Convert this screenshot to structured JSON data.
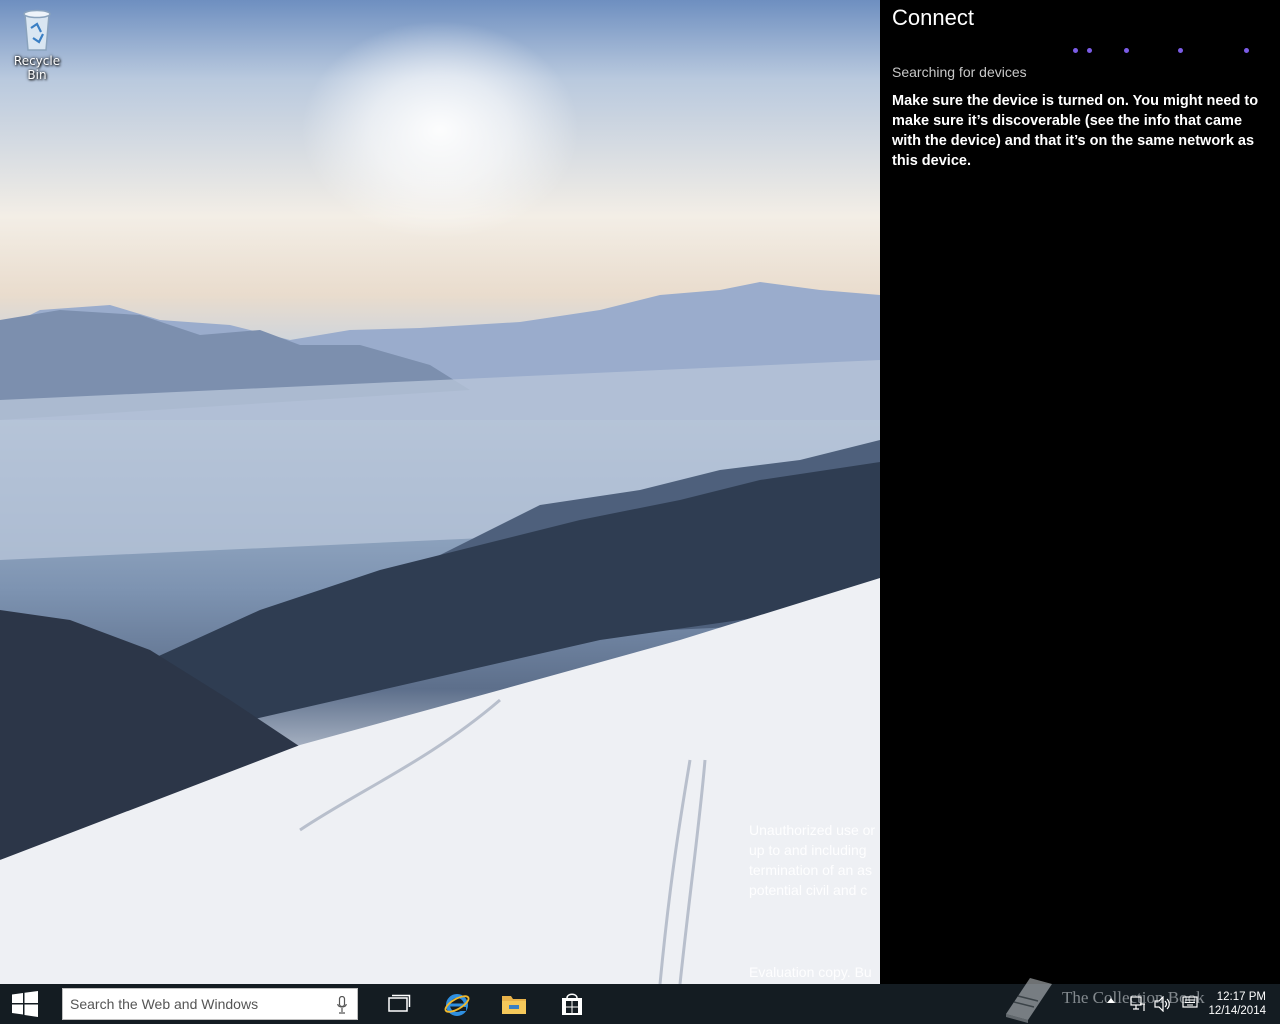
{
  "desktop": {
    "icons": [
      {
        "label": "Recycle Bin",
        "icon": "recycle-bin-icon"
      }
    ],
    "watermark_lines": [
      "Unauthorized use or",
      "up to and including",
      "termination of an as",
      "potential civil and c"
    ],
    "evaluation_text": "Evaluation copy. Bu"
  },
  "connect_pane": {
    "title": "Connect",
    "status": "Searching for devices",
    "help_text": "Make sure the device is turned on. You might need to make sure it’s discoverable (see the info that came with the device) and that it’s on the same network as this device.",
    "progress_color": "#7b5ce6"
  },
  "taskbar": {
    "start_icon": "windows-logo-icon",
    "search": {
      "placeholder": "Search the Web and Windows",
      "value": ""
    },
    "pinned": [
      {
        "name": "task-view",
        "icon": "task-view-icon"
      },
      {
        "name": "internet-explorer",
        "icon": "internet-explorer-icon"
      },
      {
        "name": "file-explorer",
        "icon": "file-explorer-icon"
      },
      {
        "name": "store",
        "icon": "store-icon"
      }
    ],
    "tray": {
      "overlay_logo_text": "The Collection Book",
      "time": "12:17 PM",
      "date": "12/14/2014"
    }
  }
}
